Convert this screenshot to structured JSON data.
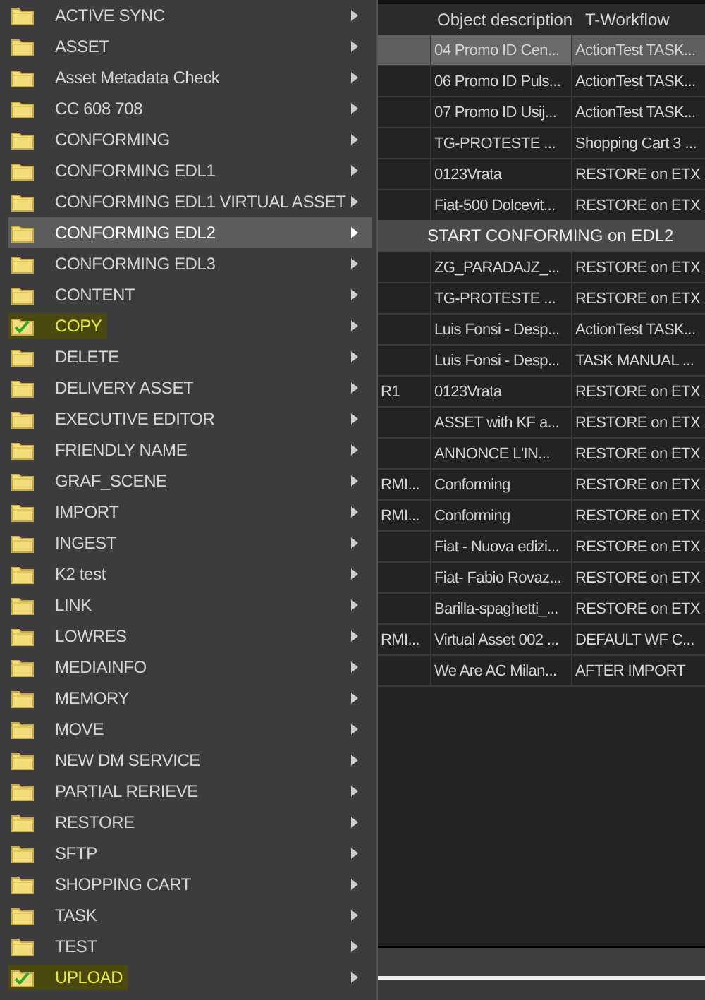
{
  "menu": {
    "items": [
      {
        "label": "ACTIVE SYNC",
        "selected": false,
        "checked": false
      },
      {
        "label": "ASSET",
        "selected": false,
        "checked": false
      },
      {
        "label": "Asset Metadata Check",
        "selected": false,
        "checked": false
      },
      {
        "label": "CC 608 708",
        "selected": false,
        "checked": false
      },
      {
        "label": "CONFORMING",
        "selected": false,
        "checked": false
      },
      {
        "label": "CONFORMING EDL1",
        "selected": false,
        "checked": false
      },
      {
        "label": "CONFORMING EDL1 VIRTUAL ASSET",
        "selected": false,
        "checked": false
      },
      {
        "label": "CONFORMING EDL2",
        "selected": true,
        "checked": false
      },
      {
        "label": "CONFORMING EDL3",
        "selected": false,
        "checked": false
      },
      {
        "label": "CONTENT",
        "selected": false,
        "checked": false
      },
      {
        "label": "COPY",
        "selected": false,
        "checked": true
      },
      {
        "label": "DELETE",
        "selected": false,
        "checked": false
      },
      {
        "label": "DELIVERY ASSET",
        "selected": false,
        "checked": false
      },
      {
        "label": "EXECUTIVE EDITOR",
        "selected": false,
        "checked": false
      },
      {
        "label": "FRIENDLY NAME",
        "selected": false,
        "checked": false
      },
      {
        "label": "GRAF_SCENE",
        "selected": false,
        "checked": false
      },
      {
        "label": "IMPORT",
        "selected": false,
        "checked": false
      },
      {
        "label": "INGEST",
        "selected": false,
        "checked": false
      },
      {
        "label": "K2 test",
        "selected": false,
        "checked": false
      },
      {
        "label": "LINK",
        "selected": false,
        "checked": false
      },
      {
        "label": "LOWRES",
        "selected": false,
        "checked": false
      },
      {
        "label": "MEDIAINFO",
        "selected": false,
        "checked": false
      },
      {
        "label": "MEMORY",
        "selected": false,
        "checked": false
      },
      {
        "label": "MOVE",
        "selected": false,
        "checked": false
      },
      {
        "label": "NEW DM SERVICE",
        "selected": false,
        "checked": false
      },
      {
        "label": "PARTIAL RERIEVE",
        "selected": false,
        "checked": false
      },
      {
        "label": "RESTORE",
        "selected": false,
        "checked": false
      },
      {
        "label": "SFTP",
        "selected": false,
        "checked": false
      },
      {
        "label": "SHOPPING CART",
        "selected": false,
        "checked": false
      },
      {
        "label": "TASK",
        "selected": false,
        "checked": false
      },
      {
        "label": "TEST",
        "selected": false,
        "checked": false
      },
      {
        "label": "UPLOAD",
        "selected": false,
        "checked": true
      }
    ]
  },
  "submenu": {
    "items": [
      {
        "label": "START CONFORMING on EDL2"
      }
    ]
  },
  "table": {
    "columns": [
      "Object description",
      "T-Workflow"
    ],
    "rows": [
      {
        "column_1": "",
        "object_description": "04 Promo ID Cen...",
        "t_workflow": "ActionTest TASK...",
        "selected": true
      },
      {
        "column_1": "",
        "object_description": "06 Promo ID Puls...",
        "t_workflow": "ActionTest TASK...",
        "selected": false
      },
      {
        "column_1": "",
        "object_description": "07 Promo ID Usij...",
        "t_workflow": "ActionTest TASK...",
        "selected": false
      },
      {
        "column_1": "",
        "object_description": "TG-PROTESTE ...",
        "t_workflow": "Shopping Cart 3 ...",
        "selected": false
      },
      {
        "column_1": "",
        "object_description": "0123Vrata",
        "t_workflow": "RESTORE on ETX",
        "selected": false
      },
      {
        "column_1": "",
        "object_description": "Fiat-500 Dolcevit...",
        "t_workflow": "RESTORE on ETX",
        "selected": false
      },
      {
        "column_1": "",
        "object_description": "ZG_PARADAJZ_...",
        "t_workflow": "RESTORE on ETX",
        "selected": false
      },
      {
        "column_1": "",
        "object_description": "TG-PROTESTE ...",
        "t_workflow": "RESTORE on ETX",
        "selected": false
      },
      {
        "column_1": "",
        "object_description": "Luis Fonsi - Desp...",
        "t_workflow": "ActionTest TASK...",
        "selected": false
      },
      {
        "column_1": "",
        "object_description": "Luis Fonsi - Desp...",
        "t_workflow": "TASK MANUAL ...",
        "selected": false
      },
      {
        "column_1": "R1",
        "object_description": "0123Vrata",
        "t_workflow": "RESTORE on ETX",
        "selected": false
      },
      {
        "column_1": "",
        "object_description": "ASSET with KF a...",
        "t_workflow": "RESTORE on ETX",
        "selected": false
      },
      {
        "column_1": "",
        "object_description": "ANNONCE L'IN...",
        "t_workflow": "RESTORE on ETX",
        "selected": false
      },
      {
        "column_1": "RMI...",
        "object_description": "Conforming",
        "t_workflow": "RESTORE on ETX",
        "selected": false
      },
      {
        "column_1": "RMI...",
        "object_description": "Conforming",
        "t_workflow": "RESTORE on ETX",
        "selected": false
      },
      {
        "column_1": "",
        "object_description": "Fiat - Nuova edizi...",
        "t_workflow": "RESTORE on ETX",
        "selected": false
      },
      {
        "column_1": "",
        "object_description": "Fiat- Fabio Rovaz...",
        "t_workflow": "RESTORE on ETX",
        "selected": false
      },
      {
        "column_1": "",
        "object_description": "Barilla-spaghetti_...",
        "t_workflow": "RESTORE on ETX",
        "selected": false
      },
      {
        "column_1": "RMI...",
        "object_description": "Virtual Asset 002 ...",
        "t_workflow": "DEFAULT WF C...",
        "selected": false
      },
      {
        "column_1": "",
        "object_description": "We Are AC Milan...",
        "t_workflow": "AFTER IMPORT",
        "selected": false
      }
    ]
  }
}
